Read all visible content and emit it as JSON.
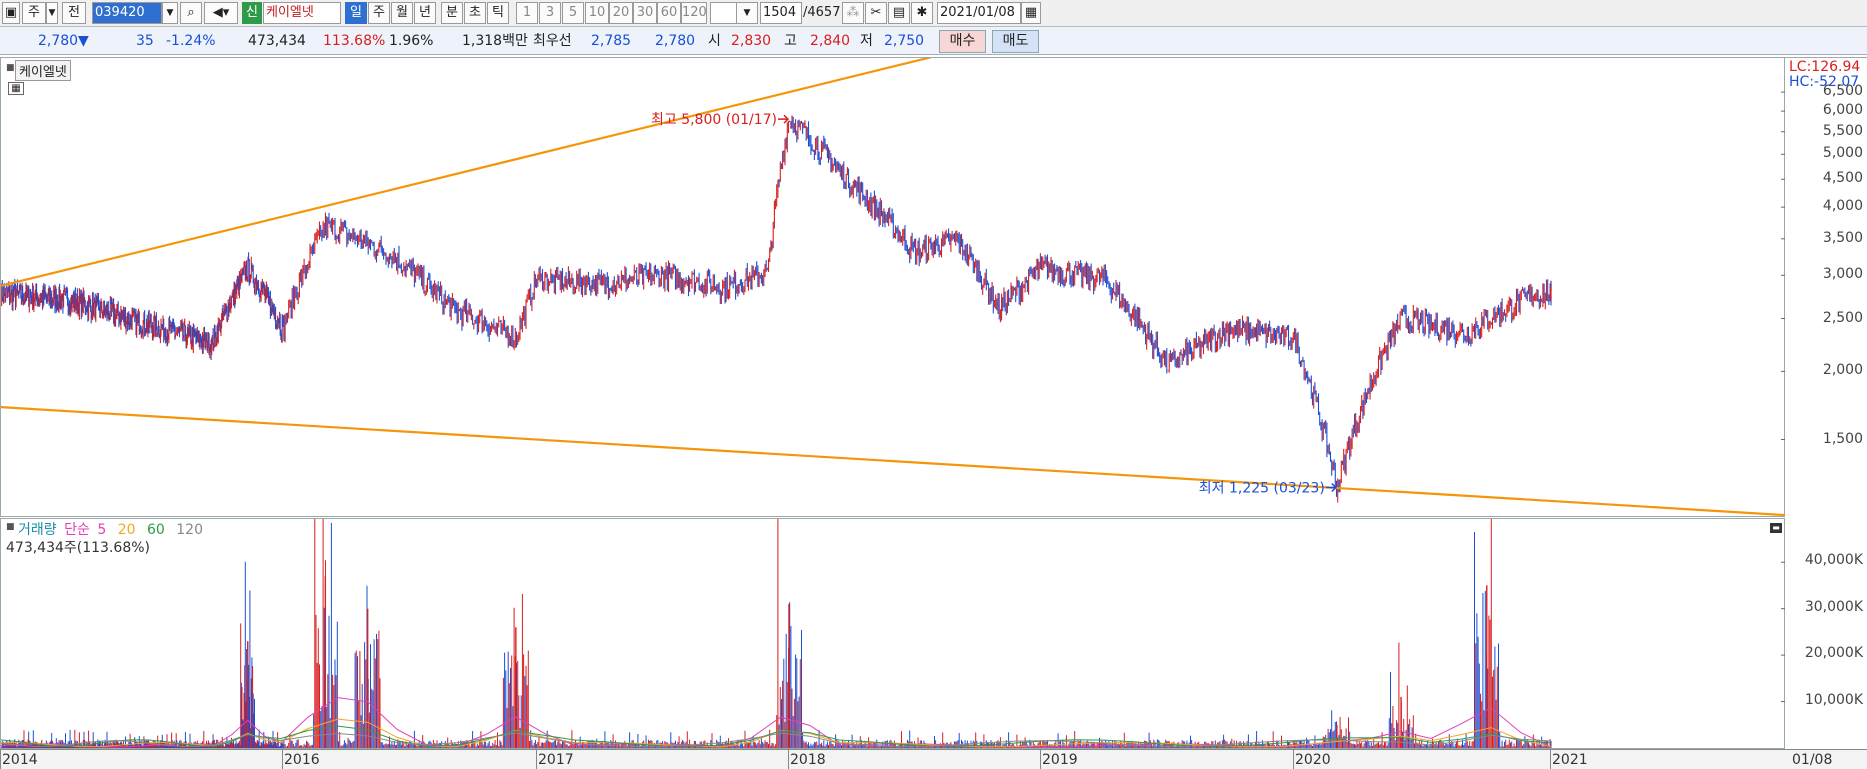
{
  "toolbar": {
    "period_unit": "주",
    "prev_label": "전",
    "code_value": "039420",
    "new_badge": "신",
    "stock_name": "케이엘넷",
    "tabs": [
      "일",
      "주",
      "월",
      "년",
      "분",
      "초",
      "틱"
    ],
    "periods": [
      "1",
      "3",
      "5",
      "10",
      "20",
      "30",
      "60",
      "120"
    ],
    "count_current": "1504",
    "count_total": "/4657",
    "date_value": "2021/01/08"
  },
  "quote": {
    "price": "2,780",
    "direction": "▼",
    "change": "35",
    "change_pct": "-1.24%",
    "volume": "473,434",
    "volume_ratio": "113.68%",
    "turnover": "1.96%",
    "amount": "1,318백만",
    "best_label": "최우선",
    "best_ask": "2,785",
    "best_bid": "2,780",
    "open_label": "시",
    "open": "2,830",
    "high_label": "고",
    "high": "2,840",
    "low_label": "저",
    "low": "2,750",
    "buy_label": "매수",
    "sell_label": "매도"
  },
  "price_panel": {
    "title": "케이엘넷",
    "lc_label": "LC:126.94",
    "hc_label": "HC:-52.07",
    "max_annotation": "최고 5,800 (01/17)",
    "min_annotation": "최저 1,225 (03/23)"
  },
  "volume_panel": {
    "legend_volume": "거래량",
    "legend_ma_label": "단순",
    "legend_ma": [
      "5",
      "20",
      "60",
      "120"
    ],
    "readout": "473,434주(113.68%)"
  },
  "colors": {
    "up": "#d81e1e",
    "down": "#1a4fd6",
    "trendline": "#f5960a",
    "ma5": "#e23fb8",
    "ma20": "#f5a623",
    "ma60": "#2e9b4b",
    "ma120": "#888888"
  },
  "chart_data": [
    {
      "type": "line",
      "title": "케이엘넷",
      "scale": "log",
      "ylim": [
        1100,
        6900
      ],
      "price_ticks": [
        "6,500",
        "6,000",
        "5,500",
        "5,000",
        "4,500",
        "4,000",
        "3,500",
        "3,000",
        "2,500",
        "2,000",
        "1,500"
      ],
      "x_ticks": [
        "2014",
        "2016",
        "2017",
        "2018",
        "2019",
        "2020",
        "2021",
        "01/08"
      ],
      "series": [
        {
          "x": [
            "2014-01",
            "2014-07",
            "2015-01",
            "2015-07",
            "2015-10",
            "2016-01",
            "2016-03",
            "2016-06",
            "2016-09",
            "2016-12",
            "2017-01",
            "2017-04",
            "2017-07",
            "2017-10",
            "2017-12",
            "2018-01",
            "2018-04",
            "2018-07",
            "2018-09",
            "2018-11",
            "2019-01",
            "2019-04",
            "2019-07",
            "2019-10",
            "2020-01",
            "2020-03",
            "2020-06",
            "2020-09",
            "2020-12",
            "2021-01"
          ],
          "values": [
            2780,
            2700,
            2450,
            2250,
            3100,
            2400,
            3700,
            3300,
            2600,
            2300,
            2950,
            2900,
            3000,
            2850,
            3050,
            5800,
            4400,
            3300,
            3500,
            2600,
            3100,
            2950,
            2050,
            2400,
            2300,
            1225,
            2500,
            2350,
            2750,
            2780
          ]
        }
      ],
      "annotations": [
        {
          "label": "최고 5,800 (01/17)",
          "x": "2018-01",
          "y": 5800
        },
        {
          "label": "최저 1,225 (03/23)",
          "x": "2020-03",
          "y": 1225
        }
      ]
    },
    {
      "type": "bar",
      "title": "거래량",
      "ylim": [
        0,
        45000
      ],
      "y_ticks": [
        "40,000K",
        "30,000K",
        "20,000K",
        "10,000K"
      ],
      "spikes": [
        {
          "x": "2015-10",
          "value": 23000
        },
        {
          "x": "2016-03",
          "value": 37000
        },
        {
          "x": "2016-05",
          "value": 30000
        },
        {
          "x": "2016-12",
          "value": 26000
        },
        {
          "x": "2018-01",
          "value": 31000
        },
        {
          "x": "2020-03",
          "value": 5000
        },
        {
          "x": "2020-06",
          "value": 11000
        },
        {
          "x": "2020-10",
          "value": 35000
        }
      ]
    }
  ]
}
